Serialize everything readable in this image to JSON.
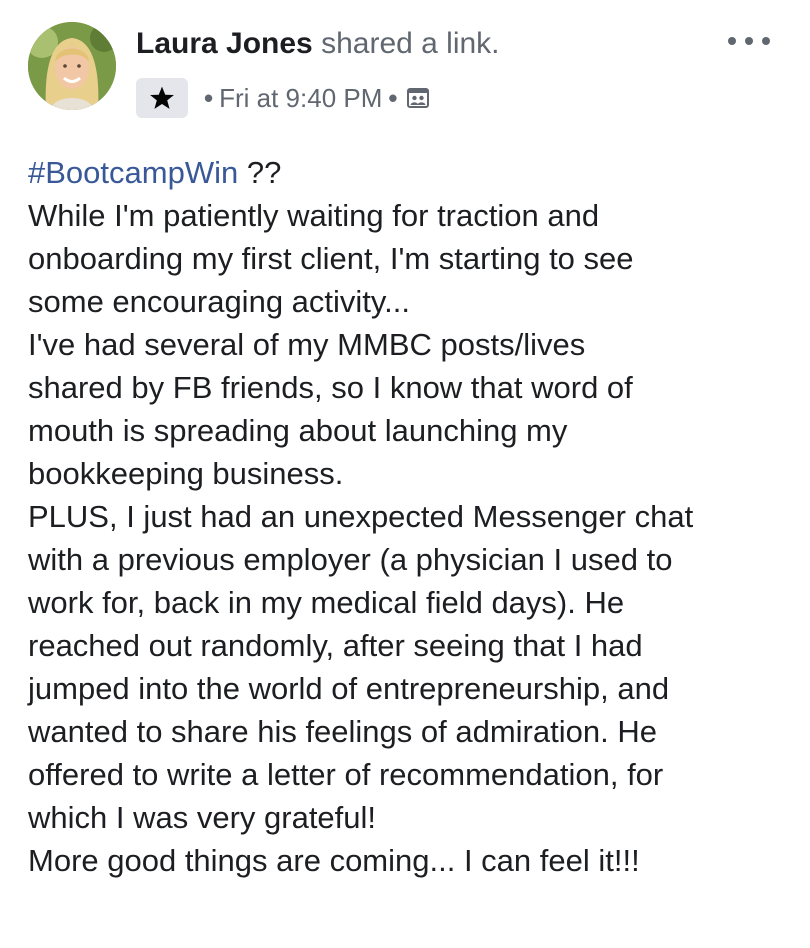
{
  "post": {
    "author": "Laura Jones",
    "action": "shared a link.",
    "timestamp": "Fri at 9:40 PM",
    "separator": "•",
    "icons": {
      "badge": "star-icon",
      "audience": "group-audience-icon",
      "menu": "more-options-icon"
    },
    "colors": {
      "hashtag": "#385898",
      "text": "#1c1e21",
      "meta": "#606770",
      "badge_bg": "#e4e6eb"
    },
    "hashtag": "#BootcampWin",
    "hashtag_suffix": " ??",
    "lines": [
      "While I'm patiently waiting for traction and",
      "onboarding my first client, I'm starting to see",
      "some encouraging activity...",
      "I've had several of my MMBC posts/lives",
      "shared by FB friends, so I know that word of",
      "mouth is spreading about launching my",
      "bookkeeping business.",
      "PLUS, I just had an unexpected Messenger chat",
      "with a previous employer (a physician I used to",
      "work for, back in my medical field days). He",
      "reached out randomly, after seeing that I had",
      "jumped into the world of entrepreneurship, and",
      "wanted to share his feelings of admiration. He",
      "offered to write a letter of recommendation, for",
      "which I was very grateful!",
      "More good things are coming... I can feel it!!!"
    ]
  }
}
